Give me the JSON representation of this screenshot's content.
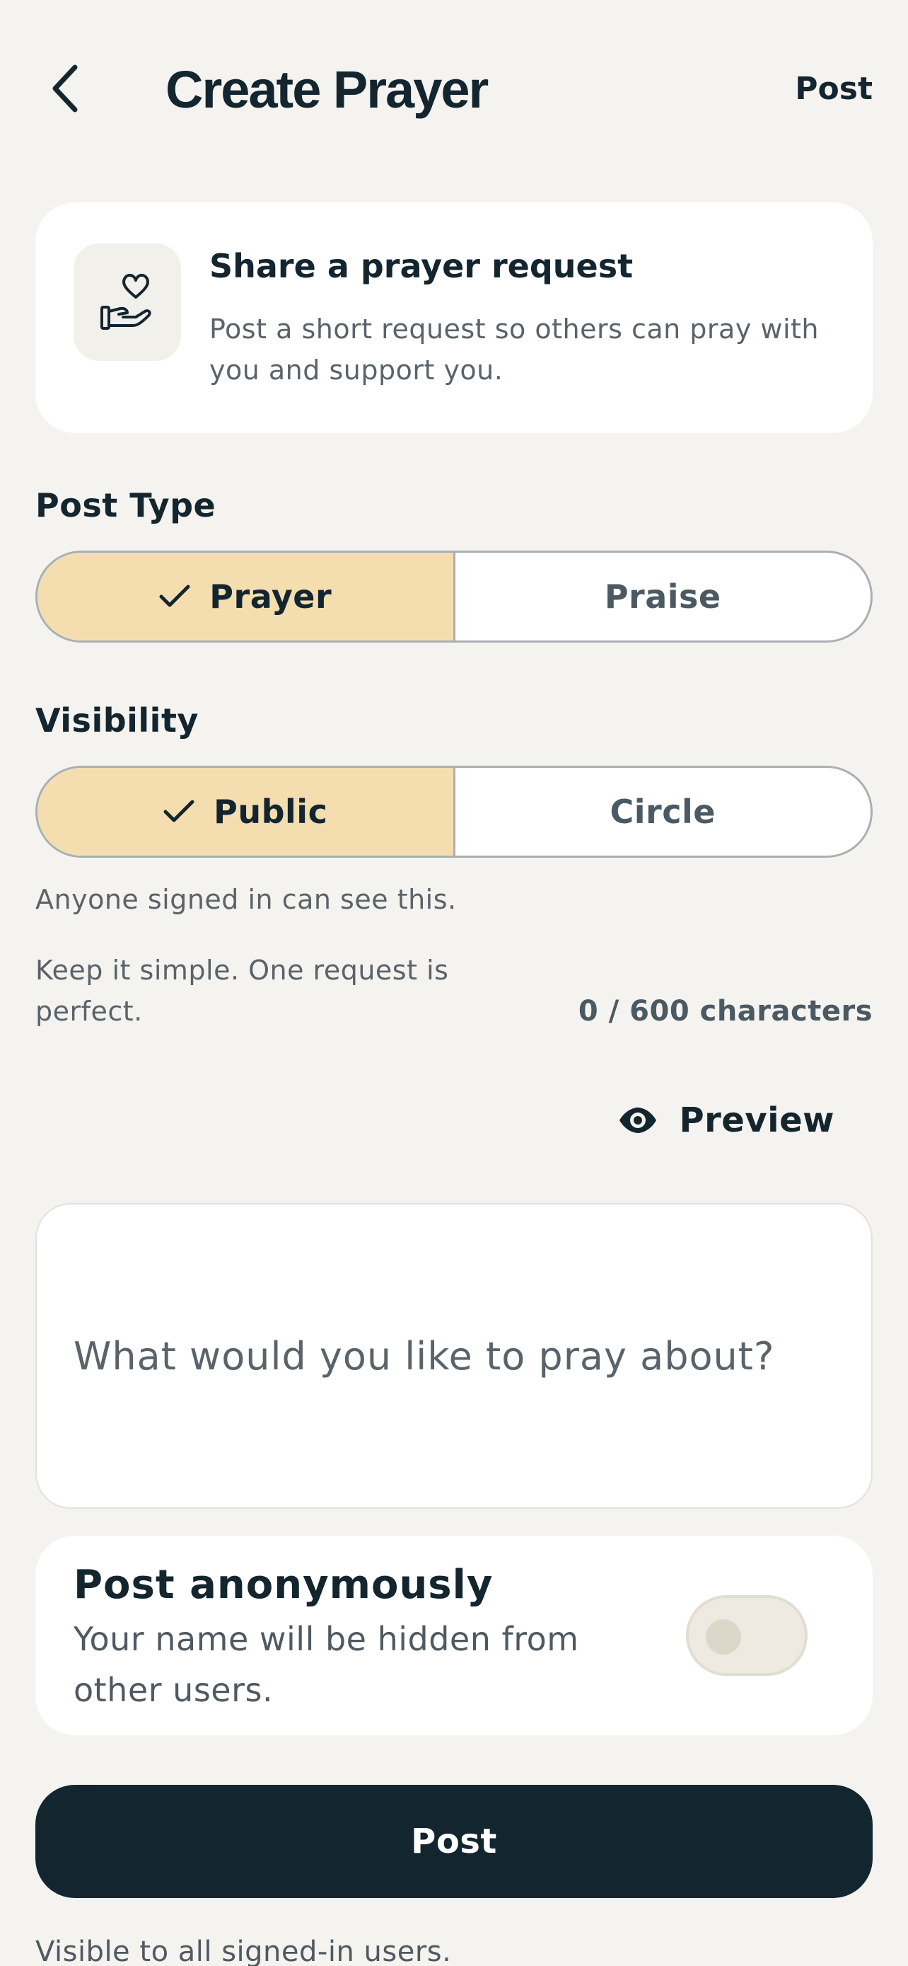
{
  "header": {
    "back_icon": "chevron-left-icon",
    "title": "Create Prayer",
    "post_label": "Post"
  },
  "intro_card": {
    "icon": "hand-heart-icon",
    "title": "Share a prayer request",
    "body": "Post a short request so others can pray with you and support you."
  },
  "post_type": {
    "label": "Post Type",
    "options": [
      {
        "label": "Prayer",
        "selected": true
      },
      {
        "label": "Praise",
        "selected": false
      }
    ]
  },
  "visibility": {
    "label": "Visibility",
    "options": [
      {
        "label": "Public",
        "selected": true
      },
      {
        "label": "Circle",
        "selected": false
      }
    ],
    "helper": "Anyone signed in can see this."
  },
  "composer": {
    "tip": "Keep it simple. One request is perfect.",
    "char_count": "0 / 600 characters",
    "preview_label": "Preview",
    "preview_icon": "eye-icon",
    "placeholder": "What would you like to pray about?"
  },
  "anonymous": {
    "title": "Post anonymously",
    "description": "Your name will be hidden from other users.",
    "enabled": false
  },
  "submit": {
    "label": "Post",
    "note": "Visible to all signed-in users."
  },
  "colors": {
    "background": "#F5F3EF",
    "card": "#FFFFFF",
    "primary": "#13252E",
    "selected_segment": "#F4DEB0",
    "muted_text": "#5A636A",
    "border": "#A9AFB3"
  }
}
